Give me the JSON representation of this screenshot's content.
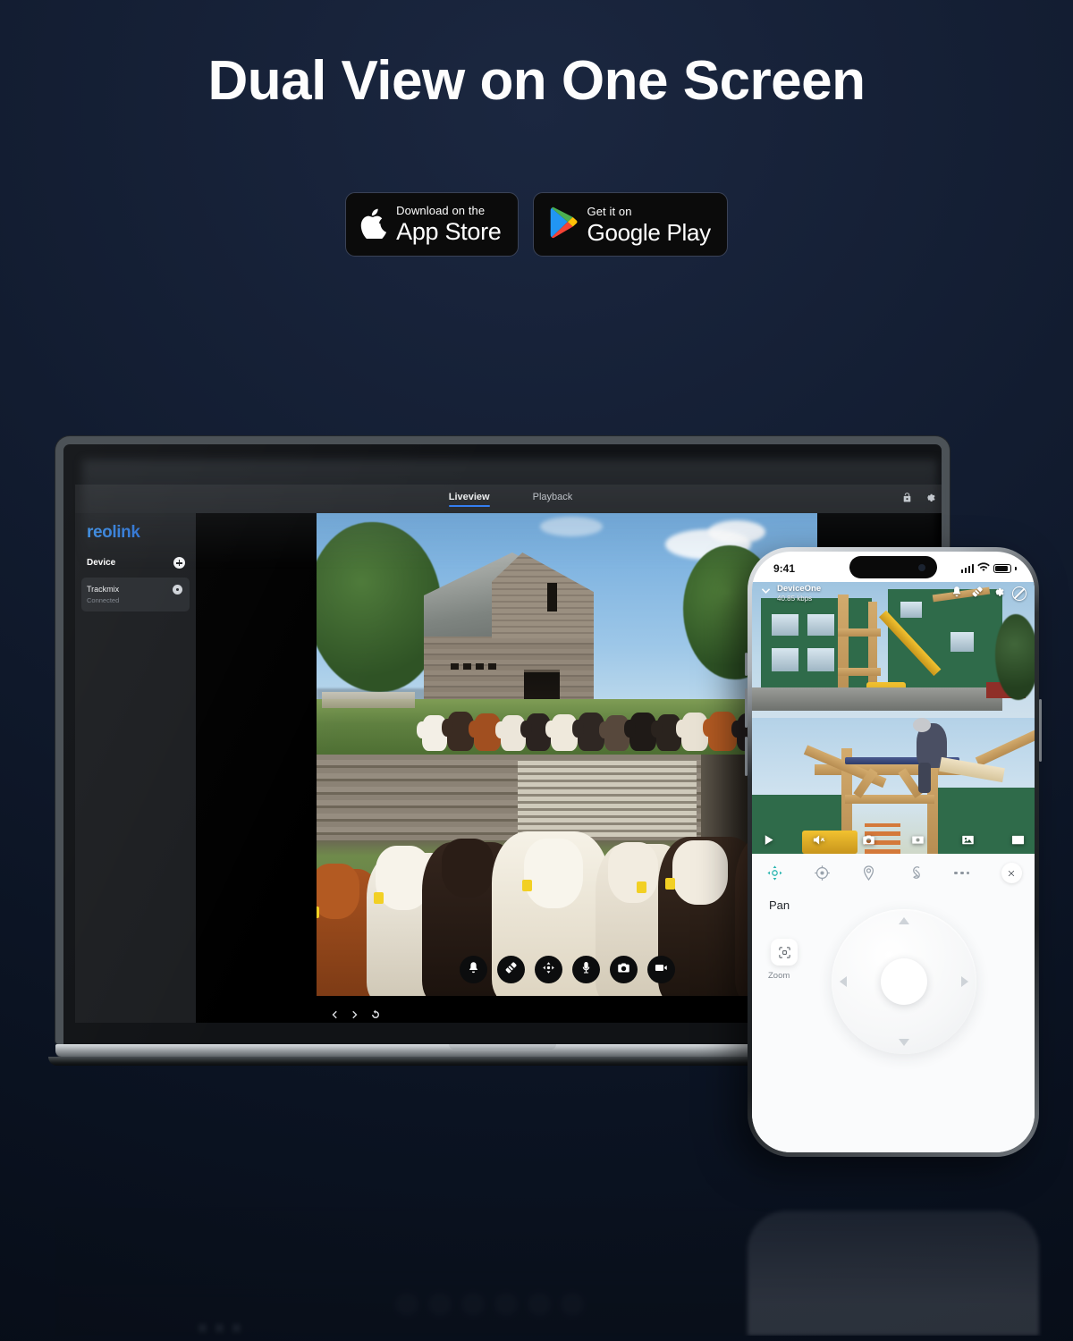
{
  "hero": {
    "headline": "Dual View on One Screen",
    "background_color": "#111c2f"
  },
  "store_badges": [
    {
      "id": "app-store",
      "icon": "apple-logo-icon",
      "small_text": "Download on the",
      "big_text": "App Store"
    },
    {
      "id": "google-play",
      "icon": "google-play-icon",
      "small_text": "Get it on",
      "big_text": "Google Play"
    }
  ],
  "desktop_app": {
    "brand": "reolink",
    "brand_color": "#2f7fd9",
    "tabs": [
      {
        "label": "Liveview",
        "active": true
      },
      {
        "label": "Playback",
        "active": false
      }
    ],
    "header_icons": [
      "lock-icon",
      "gear-icon"
    ],
    "sidebar": {
      "section_label": "Device",
      "add_icon": "plus-circle-icon",
      "devices": [
        {
          "name": "Trackmix",
          "status": "Connected",
          "settings_icon": "gear-icon",
          "selected": true
        }
      ]
    },
    "dock_buttons": [
      {
        "name": "siren-button",
        "icon": "siren-icon"
      },
      {
        "name": "spotlight-button",
        "icon": "spotlight-icon"
      },
      {
        "name": "ptz-button",
        "icon": "ptz-move-icon"
      },
      {
        "name": "talk-button",
        "icon": "microphone-icon"
      },
      {
        "name": "snapshot-button",
        "icon": "camera-icon"
      },
      {
        "name": "record-button",
        "icon": "video-camera-icon"
      }
    ],
    "bottom_nav": [
      {
        "name": "previous-button",
        "icon": "chevron-left-icon"
      },
      {
        "name": "next-button",
        "icon": "chevron-right-icon"
      },
      {
        "name": "refresh-button",
        "icon": "refresh-icon"
      }
    ],
    "liveview": {
      "layout": "dual-view-stacked",
      "top_pane_scene": "wide-angle view of weathered wooden barn with herd of cattle on green pasture",
      "bottom_pane_scene": "telephoto close-up of cattle with yellow ear tags in front of barn siding"
    }
  },
  "phone_app": {
    "status_bar": {
      "time": "9:41",
      "signal_icon": "cellular-bars-icon",
      "wifi_icon": "wifi-icon",
      "battery_icon": "battery-icon"
    },
    "stream_header": {
      "collapse_icon": "chevron-down-icon",
      "device_name": "DeviceOne",
      "bitrate": "40.85 kbps",
      "icons": [
        "siren-icon",
        "spotlight-icon",
        "gear-icon",
        "disabled-circle-icon"
      ]
    },
    "stream_toolbar": [
      {
        "name": "play-button",
        "icon": "play-icon"
      },
      {
        "name": "mute-button",
        "icon": "speaker-mute-icon"
      },
      {
        "name": "snapshot-button",
        "icon": "camera-icon"
      },
      {
        "name": "record-button",
        "icon": "record-box-icon"
      },
      {
        "name": "gallery-button",
        "icon": "image-icon"
      },
      {
        "name": "pip-button",
        "icon": "picture-in-picture-icon"
      }
    ],
    "liveview": {
      "layout": "dual-view-stacked",
      "top_pane_scene": "wide view of multi-story building under construction with green sheathing and yellow telehandler crane",
      "bottom_pane_scene": "telephoto of worker on timber-frame roof trusses"
    },
    "ptz_panel": {
      "tabs": [
        {
          "name": "tab-pan",
          "icon": "ptz-move-icon",
          "active": true
        },
        {
          "name": "tab-focus",
          "icon": "focus-target-icon",
          "active": false
        },
        {
          "name": "tab-preset",
          "icon": "location-preset-icon",
          "active": false
        },
        {
          "name": "tab-track",
          "icon": "patrol-track-icon",
          "active": false
        },
        {
          "name": "tab-more",
          "icon": "more-dots-icon",
          "active": false
        }
      ],
      "close_icon": "close-icon",
      "active_mode_title": "Pan",
      "zoom_button": {
        "label": "Zoom",
        "icon": "zoom-frame-icon"
      },
      "dpad": {
        "up_icon": "triangle-up-icon",
        "down_icon": "triangle-down-icon",
        "left_icon": "triangle-left-icon",
        "right_icon": "triangle-right-icon",
        "center_name": "dpad-center-button"
      },
      "accent_color": "#2ab5b0"
    }
  }
}
